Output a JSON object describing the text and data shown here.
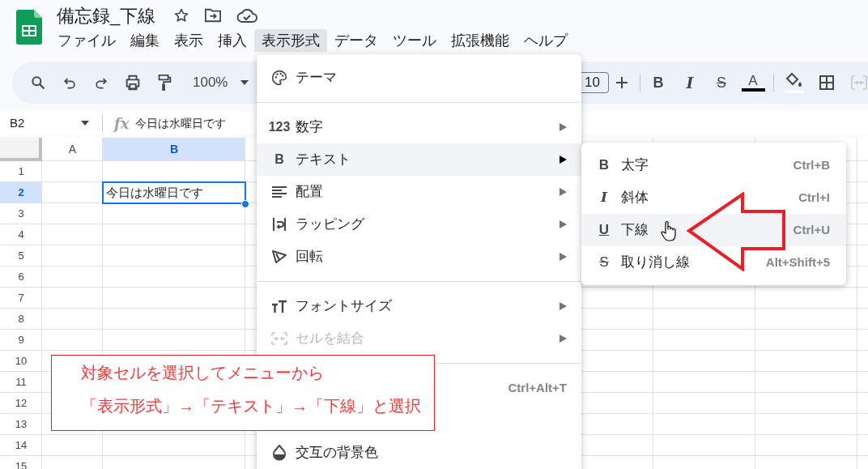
{
  "document": {
    "title": "備忘録_下線"
  },
  "menu_bar": [
    {
      "label": "ファイル",
      "selected": false
    },
    {
      "label": "編集",
      "selected": false
    },
    {
      "label": "表示",
      "selected": false
    },
    {
      "label": "挿入",
      "selected": false
    },
    {
      "label": "表示形式",
      "selected": true
    },
    {
      "label": "データ",
      "selected": false
    },
    {
      "label": "ツール",
      "selected": false
    },
    {
      "label": "拡張機能",
      "selected": false
    },
    {
      "label": "ヘルプ",
      "selected": false
    }
  ],
  "toolbar": {
    "zoom": "100%",
    "font_size": "10",
    "bold": "B",
    "italic": "I",
    "strikethrough": "S",
    "text_color": "A"
  },
  "formula_bar": {
    "cell_ref": "B2",
    "fx": "fx",
    "value": "今日は水曜日です"
  },
  "grid": {
    "columns": [
      {
        "label": "A",
        "selected": false
      },
      {
        "label": "B",
        "selected": true
      }
    ],
    "rows": [
      {
        "label": "1",
        "selected": false
      },
      {
        "label": "2",
        "selected": true,
        "cell_b": "今日は水曜日です"
      },
      {
        "label": "3",
        "selected": false
      },
      {
        "label": "4",
        "selected": false
      },
      {
        "label": "5",
        "selected": false
      },
      {
        "label": "6",
        "selected": false
      },
      {
        "label": "7",
        "selected": false
      },
      {
        "label": "8",
        "selected": false
      },
      {
        "label": "9",
        "selected": false
      },
      {
        "label": "10",
        "selected": false
      },
      {
        "label": "11",
        "selected": false
      },
      {
        "label": "12",
        "selected": false
      },
      {
        "label": "13",
        "selected": false
      },
      {
        "label": "14",
        "selected": false
      },
      {
        "label": "15",
        "selected": false
      }
    ]
  },
  "format_menu": {
    "items": [
      {
        "kind": "item",
        "label": "テーマ",
        "has_submenu": false,
        "selected": false,
        "disabled": false
      },
      {
        "kind": "divider"
      },
      {
        "kind": "item",
        "glyph": "123",
        "label": "数字",
        "has_submenu": true,
        "selected": false,
        "disabled": false
      },
      {
        "kind": "item",
        "glyph": "B",
        "label": "テキスト",
        "has_submenu": true,
        "selected": true,
        "disabled": false
      },
      {
        "kind": "item",
        "label": "配置",
        "has_submenu": true,
        "selected": false,
        "disabled": false
      },
      {
        "kind": "item",
        "label": "ラッピング",
        "has_submenu": true,
        "selected": false,
        "disabled": false
      },
      {
        "kind": "item",
        "label": "回転",
        "has_submenu": true,
        "selected": false,
        "disabled": false
      },
      {
        "kind": "divider"
      },
      {
        "kind": "item",
        "label": "フォントサイズ",
        "has_submenu": true,
        "selected": false,
        "disabled": false
      },
      {
        "kind": "item",
        "label": "セルを結合",
        "has_submenu": true,
        "selected": false,
        "disabled": true
      },
      {
        "kind": "divider"
      },
      {
        "kind": "item",
        "shortcut": "Ctrl+Alt+T",
        "has_submenu": false,
        "selected": false,
        "disabled": false
      },
      {
        "kind": "covered"
      },
      {
        "kind": "item",
        "label": "交互の背景色",
        "has_submenu": false,
        "selected": false,
        "disabled": false
      }
    ]
  },
  "text_submenu": {
    "items": [
      {
        "glyph": "B",
        "label": "太字",
        "shortcut": "Ctrl+B",
        "selected": false
      },
      {
        "glyph": "I",
        "label": "斜体",
        "shortcut": "Ctrl+I",
        "selected": false
      },
      {
        "glyph": "U",
        "label": "下線",
        "shortcut": "Ctrl+U",
        "selected": true
      },
      {
        "glyph": "S",
        "label": "取り消し線",
        "shortcut": "Alt+Shift+5",
        "selected": false
      }
    ]
  },
  "annotation": {
    "lines": [
      "対象セルを選択してメニューから",
      "「表示形式」→「テキスト」→「下線」と選択"
    ]
  }
}
